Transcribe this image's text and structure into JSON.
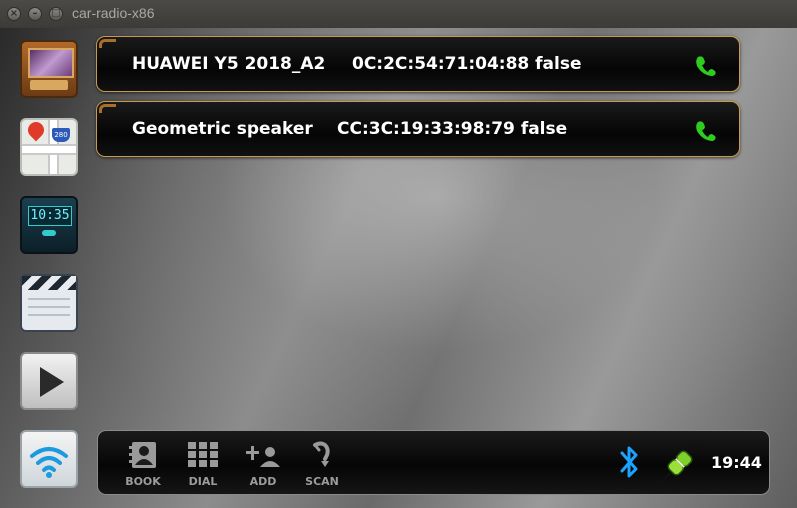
{
  "window": {
    "title": "car-radio-x86",
    "close_glyph": "×",
    "minimize_glyph": "–",
    "maximize_glyph": "□"
  },
  "sidebar": {
    "apps": [
      {
        "name": "radio",
        "icon": "radio-icon"
      },
      {
        "name": "navigation",
        "icon": "map-icon"
      },
      {
        "name": "clock",
        "icon": "clock-icon",
        "display": "10:35"
      },
      {
        "name": "video",
        "icon": "clapperboard-icon"
      },
      {
        "name": "player",
        "icon": "play-icon"
      },
      {
        "name": "wifi",
        "icon": "wifi-icon"
      }
    ],
    "map_shield": "280"
  },
  "devices": [
    {
      "name": "HUAWEI Y5 2018_A2",
      "mac": "0C:2C:54:71:04:88",
      "paired": "false"
    },
    {
      "name": "Geometric speaker",
      "mac": "CC:3C:19:33:98:79",
      "paired": "false"
    }
  ],
  "toolbar": {
    "book_label": "BOOK",
    "dial_label": "DIAL",
    "add_label": "ADD",
    "scan_label": "SCAN"
  },
  "status": {
    "time": "19:44",
    "bluetooth_icon": "bluetooth-icon",
    "connection_icon": "plug-icon"
  },
  "colors": {
    "call_green": "#2ecc1f",
    "bluetooth_blue": "#1aa3ff",
    "row_border": "#c99a4a"
  }
}
